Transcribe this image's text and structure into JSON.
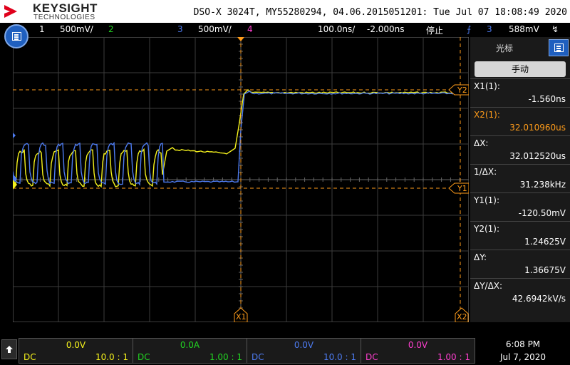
{
  "header": {
    "brand": "KEYSIGHT",
    "brand_sub": "TECHNOLOGIES",
    "model": "DSO-X 3024T, MY55280294, 04.06.2015051201: Tue Jul 07 18:08:49 2020"
  },
  "channel_bar": {
    "ch1_num": "1",
    "ch1_scale": "500mV/",
    "ch2_num": "2",
    "ch3_num": "3",
    "ch3_scale": "500mV/",
    "ch4_num": "4",
    "timebase": "100.0ns/",
    "delay": "-2.000ns",
    "run_state": "停止",
    "trigger_source": "3",
    "trigger_level": "588mV"
  },
  "plot": {
    "markers": {
      "x1": "X1",
      "x2": "X2",
      "y1": "Y1",
      "y2": "Y2",
      "trig": "T"
    }
  },
  "panel": {
    "title": "光标",
    "mode": "手动",
    "measurements": [
      {
        "label": "X1(1):",
        "value": "-1.560ns"
      },
      {
        "label": "X2(1):",
        "value": "32.010960us"
      },
      {
        "label": "ΔX:",
        "value": "32.012520us"
      },
      {
        "label": "1/ΔX:",
        "value": "31.238kHz"
      },
      {
        "label": "Y1(1):",
        "value": "-120.50mV"
      },
      {
        "label": "Y2(1):",
        "value": "1.24625V"
      },
      {
        "label": "ΔY:",
        "value": "1.36675V"
      },
      {
        "label": "ΔY/ΔX:",
        "value": "42.6942kV/s"
      }
    ]
  },
  "channels": [
    {
      "offset": "0.0V",
      "coupling": "DC",
      "probe": "10.0 : 1",
      "color": "#f5f21c"
    },
    {
      "offset": "0.0A",
      "coupling": "DC",
      "probe": "1.00 : 1",
      "color": "#22d322"
    },
    {
      "offset": "0.0V",
      "coupling": "DC",
      "probe": "10.0 : 1",
      "color": "#4d7bf0"
    },
    {
      "offset": "0.0V",
      "coupling": "DC",
      "probe": "1.00 : 1",
      "color": "#ff3fd0"
    }
  ],
  "clock": {
    "time": "6:08 PM",
    "date": "Jul 7, 2020"
  },
  "colors": {
    "ch1": "#f5f21c",
    "ch2": "#22d322",
    "ch3": "#4d7bf0",
    "ch4": "#ff3fd0",
    "cursor": "#ff9c1a"
  }
}
